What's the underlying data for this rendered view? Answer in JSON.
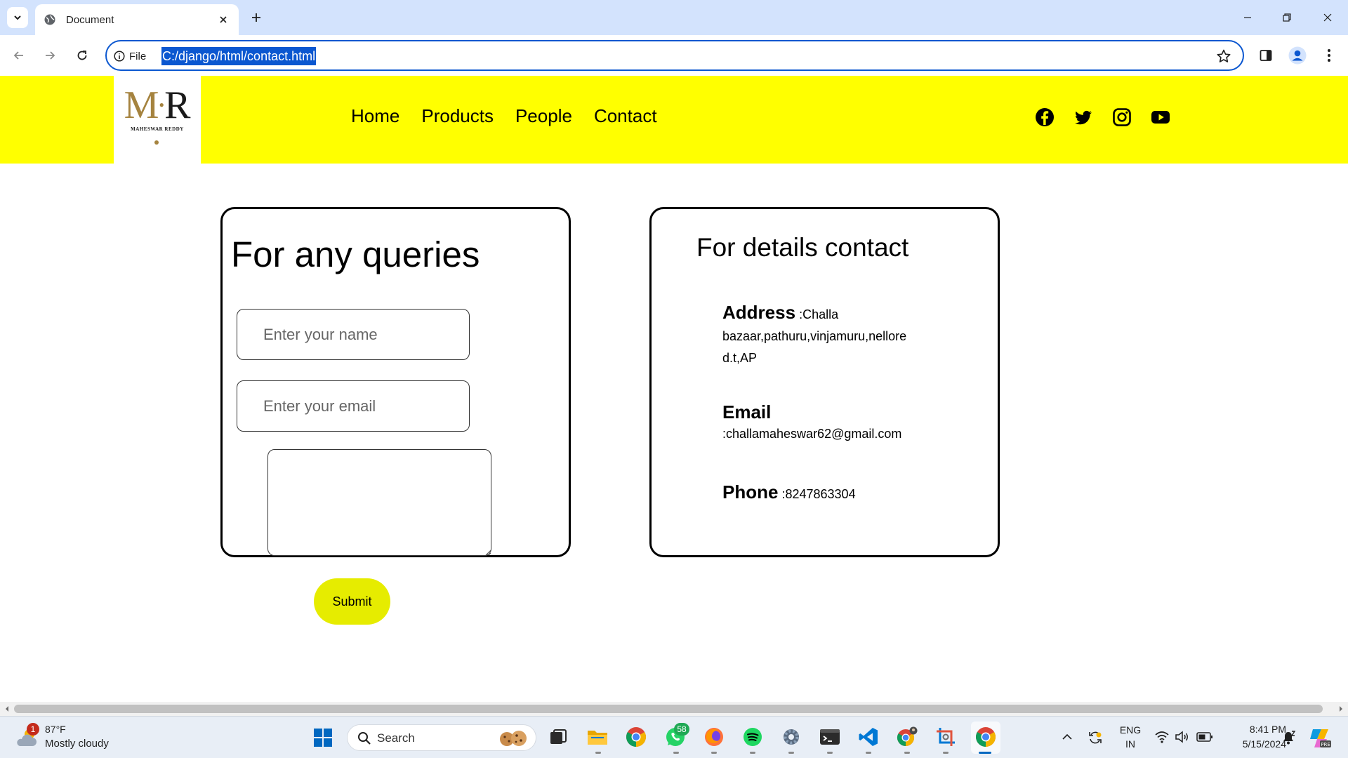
{
  "browser": {
    "tab_title": "Document",
    "site_chip": "File",
    "url": "C:/django/html/contact.html"
  },
  "site": {
    "logo": {
      "mark_m": "M",
      "mark_r": "R",
      "subtitle": "MAHESWAR REDDY"
    },
    "nav": [
      {
        "label": "Home"
      },
      {
        "label": "Products"
      },
      {
        "label": "People"
      },
      {
        "label": "Contact"
      }
    ],
    "social_icons": [
      "facebook-icon",
      "twitter-icon",
      "instagram-icon",
      "youtube-icon"
    ],
    "colors": {
      "navbar": "#ffff00",
      "submit": "#e6ec00",
      "card_border": "#000000"
    }
  },
  "query_form": {
    "title": "For any queries",
    "name_placeholder": "Enter your name",
    "email_placeholder": "Enter your email",
    "message_value": "",
    "submit_label": "Submit"
  },
  "contact": {
    "title": "For details contact",
    "address_label": "Address",
    "address_value": ":Challa bazaar,pathuru,vinjamuru,nellore d.t,AP",
    "email_label": "Email",
    "email_value": ":challamaheswar62@gmail.com",
    "phone_label": "Phone",
    "phone_value": ":8247863304"
  },
  "taskbar": {
    "weather_alert_count": "1",
    "weather_temp": "87°F",
    "weather_desc": "Mostly cloudy",
    "search_label": "Search",
    "whatsapp_badge": "58",
    "language_line1": "ENG",
    "language_line2": "IN",
    "time": "8:41 PM",
    "date": "5/15/2024"
  }
}
